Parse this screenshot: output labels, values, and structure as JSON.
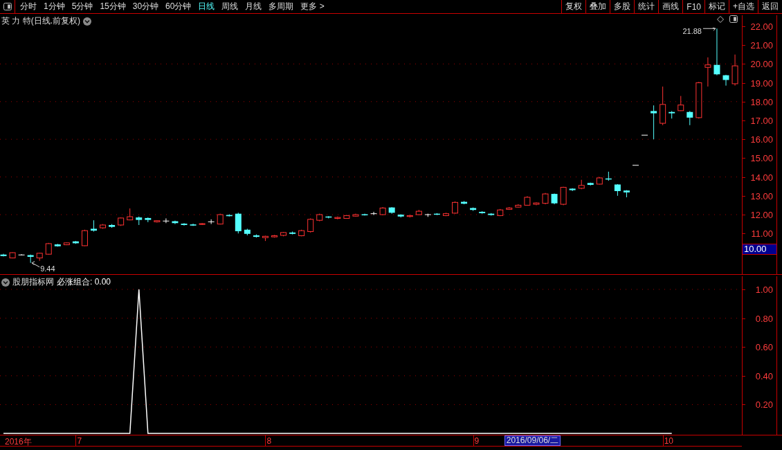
{
  "toolbar": {
    "periods": [
      {
        "label": "分时",
        "selected": false
      },
      {
        "label": "1分钟",
        "selected": false
      },
      {
        "label": "5分钟",
        "selected": false
      },
      {
        "label": "15分钟",
        "selected": false
      },
      {
        "label": "30分钟",
        "selected": false
      },
      {
        "label": "60分钟",
        "selected": false
      },
      {
        "label": "日线",
        "selected": true
      },
      {
        "label": "周线",
        "selected": false
      },
      {
        "label": "月线",
        "selected": false
      },
      {
        "label": "多周期",
        "selected": false
      },
      {
        "label": "更多 >",
        "selected": false
      }
    ],
    "buttons": [
      "复权",
      "叠加",
      "多股",
      "统计",
      "画线",
      "F10",
      "标记",
      "+自选",
      "返回"
    ]
  },
  "main_pane": {
    "title": "英 力 特(日线.前复权)",
    "cursor_price": "10.00",
    "low_label": "9.44",
    "high_label": "21.88",
    "chart_data": {
      "type": "candlestick",
      "ylim": [
        8.84,
        22.66
      ],
      "yticks": [
        {
          "value": 22,
          "label": "22.00"
        },
        {
          "value": 21,
          "label": "21.00"
        },
        {
          "value": 20,
          "label": "20.00"
        },
        {
          "value": 19,
          "label": "19.00"
        },
        {
          "value": 18,
          "label": "18.00"
        },
        {
          "value": 17,
          "label": "17.00"
        },
        {
          "value": 16,
          "label": "16.00"
        },
        {
          "value": 15,
          "label": "15.00"
        },
        {
          "value": 14,
          "label": "14.00"
        },
        {
          "value": 13,
          "label": "13.00"
        },
        {
          "value": 12,
          "label": "12.00"
        },
        {
          "value": 11,
          "label": "11.00"
        }
      ],
      "grid": true,
      "categories": [
        null,
        null,
        null,
        null,
        null,
        null,
        null,
        null,
        null,
        null,
        null,
        null,
        null,
        null,
        null,
        null,
        null,
        null,
        null,
        null,
        null,
        null,
        null,
        null,
        null,
        null,
        null,
        null,
        null,
        null,
        null,
        null,
        null,
        null,
        null,
        null,
        null,
        null,
        null,
        null,
        null,
        null,
        null,
        null,
        null,
        null,
        null,
        null,
        null,
        null,
        null,
        null,
        null,
        null,
        null,
        null,
        null,
        null,
        null,
        null,
        null,
        null,
        null,
        null,
        null,
        null,
        null,
        null,
        null,
        null,
        null,
        null,
        null,
        null,
        null,
        null,
        null,
        null,
        null,
        null,
        null,
        null
      ],
      "ohlc": [
        [
          9.88,
          9.92,
          9.78,
          9.8
        ],
        [
          9.7,
          10.0,
          9.68,
          9.98
        ],
        [
          9.86,
          9.9,
          9.84,
          9.86
        ],
        [
          9.85,
          9.88,
          9.44,
          9.76
        ],
        [
          9.7,
          9.98,
          9.55,
          9.95
        ],
        [
          9.9,
          10.5,
          9.88,
          10.46
        ],
        [
          10.42,
          10.45,
          10.3,
          10.32
        ],
        [
          10.4,
          10.52,
          10.38,
          10.5
        ],
        [
          10.58,
          10.6,
          10.45,
          10.48
        ],
        [
          10.35,
          11.2,
          10.33,
          11.15
        ],
        [
          11.25,
          11.7,
          11.1,
          11.15
        ],
        [
          11.3,
          11.5,
          11.25,
          11.45
        ],
        [
          11.45,
          11.5,
          11.3,
          11.35
        ],
        [
          11.45,
          11.85,
          11.4,
          11.82
        ],
        [
          11.72,
          12.33,
          11.7,
          11.89
        ],
        [
          11.85,
          11.9,
          11.45,
          11.72
        ],
        [
          11.82,
          11.85,
          11.6,
          11.72
        ],
        [
          11.62,
          11.7,
          11.58,
          11.68
        ],
        [
          11.66,
          11.8,
          11.55,
          11.66
        ],
        [
          11.65,
          11.68,
          11.5,
          11.55
        ],
        [
          11.52,
          11.55,
          11.42,
          11.45
        ],
        [
          11.48,
          11.52,
          11.4,
          11.42
        ],
        [
          11.48,
          11.55,
          11.45,
          11.52
        ],
        [
          11.62,
          11.75,
          11.5,
          11.62
        ],
        [
          11.5,
          12.05,
          11.48,
          12.0
        ],
        [
          11.98,
          12.02,
          11.9,
          11.92
        ],
        [
          12.05,
          12.1,
          11.0,
          11.12
        ],
        [
          11.2,
          11.25,
          10.9,
          10.98
        ],
        [
          10.9,
          10.95,
          10.78,
          10.82
        ],
        [
          10.78,
          10.88,
          10.6,
          10.85
        ],
        [
          10.82,
          10.92,
          10.78,
          10.88
        ],
        [
          10.9,
          11.08,
          10.85,
          11.05
        ],
        [
          11.05,
          11.1,
          10.95,
          10.98
        ],
        [
          10.88,
          11.2,
          10.85,
          11.15
        ],
        [
          11.1,
          11.8,
          11.05,
          11.75
        ],
        [
          11.7,
          12.05,
          11.65,
          12.0
        ],
        [
          11.9,
          11.92,
          11.8,
          11.85
        ],
        [
          11.8,
          11.9,
          11.75,
          11.85
        ],
        [
          11.8,
          11.98,
          11.78,
          11.95
        ],
        [
          11.92,
          12.05,
          11.9,
          12.0
        ],
        [
          12.02,
          12.05,
          11.95,
          11.98
        ],
        [
          12.05,
          12.15,
          11.98,
          12.05
        ],
        [
          12.0,
          12.4,
          11.98,
          12.35
        ],
        [
          12.38,
          12.4,
          12.05,
          12.1
        ],
        [
          12.0,
          12.02,
          11.85,
          11.9
        ],
        [
          11.9,
          11.98,
          11.85,
          11.95
        ],
        [
          12.0,
          12.25,
          11.98,
          12.18
        ],
        [
          12.0,
          12.05,
          11.88,
          12.0
        ],
        [
          12.05,
          12.08,
          11.98,
          12.0
        ],
        [
          11.95,
          12.1,
          11.92,
          12.05
        ],
        [
          12.08,
          12.7,
          12.05,
          12.65
        ],
        [
          12.68,
          12.72,
          12.55,
          12.58
        ],
        [
          12.35,
          12.38,
          12.2,
          12.25
        ],
        [
          12.15,
          12.18,
          12.05,
          12.08
        ],
        [
          12.05,
          12.08,
          11.95,
          11.98
        ],
        [
          11.95,
          12.3,
          11.92,
          12.25
        ],
        [
          12.28,
          12.4,
          12.25,
          12.35
        ],
        [
          12.4,
          12.55,
          12.38,
          12.5
        ],
        [
          12.5,
          12.98,
          12.48,
          12.92
        ],
        [
          12.55,
          12.65,
          12.5,
          12.62
        ],
        [
          12.6,
          13.15,
          12.55,
          13.1
        ],
        [
          13.1,
          13.12,
          12.55,
          12.6
        ],
        [
          12.55,
          13.48,
          12.5,
          13.45
        ],
        [
          13.38,
          13.4,
          13.25,
          13.3
        ],
        [
          13.4,
          13.85,
          13.35,
          13.55
        ],
        [
          13.68,
          13.7,
          13.55,
          13.58
        ],
        [
          13.62,
          14.0,
          13.6,
          13.95
        ],
        [
          13.92,
          14.28,
          13.8,
          13.88
        ],
        [
          13.6,
          13.62,
          13.0,
          13.25
        ],
        [
          13.28,
          13.3,
          12.92,
          13.18
        ],
        [
          14.62,
          14.62,
          14.62,
          14.62
        ],
        [
          16.22,
          16.22,
          16.22,
          16.22
        ],
        [
          17.5,
          17.8,
          16.0,
          17.38
        ],
        [
          16.85,
          18.8,
          16.75,
          17.85
        ],
        [
          17.45,
          17.5,
          17.1,
          17.38
        ],
        [
          17.52,
          18.3,
          17.5,
          17.82
        ],
        [
          17.45,
          17.5,
          16.75,
          17.15
        ],
        [
          17.15,
          19.05,
          17.1,
          19.0
        ],
        [
          19.82,
          20.35,
          18.8,
          19.95
        ],
        [
          19.95,
          21.88,
          19.4,
          19.45
        ],
        [
          19.4,
          19.42,
          18.85,
          19.15
        ],
        [
          18.95,
          20.5,
          18.85,
          19.9
        ]
      ]
    }
  },
  "indicator_pane": {
    "source": "股朋指标网",
    "reading": "必涨组合: 0.00",
    "chart_data": {
      "type": "line",
      "ylim": [
        0,
        1
      ],
      "grid": true,
      "yticks": [
        {
          "value": 1,
          "label": "1.00"
        },
        {
          "value": 0.8,
          "label": "0.80"
        },
        {
          "value": 0.6,
          "label": "0.60"
        },
        {
          "value": 0.4,
          "label": "0.40"
        },
        {
          "value": 0.2,
          "label": "0.20"
        }
      ],
      "series": [
        {
          "color": "#ffffff",
          "values": [
            0,
            0,
            0,
            0,
            0,
            0,
            0,
            0,
            0,
            0,
            0,
            0,
            0,
            0,
            0,
            1,
            0,
            0,
            0,
            0,
            0,
            0,
            0,
            0,
            0,
            0,
            0,
            0,
            0,
            0,
            0,
            0,
            0,
            0,
            0,
            0,
            0,
            0,
            0,
            0,
            0,
            0,
            0,
            0,
            0,
            0,
            0,
            0,
            0,
            0,
            0,
            0,
            0,
            0,
            0,
            0,
            0,
            0,
            0,
            0,
            0,
            0,
            0,
            0,
            0,
            0,
            0,
            0,
            0,
            0,
            0,
            0,
            0,
            0,
            0
          ]
        }
      ]
    }
  },
  "date_bar": {
    "labels": [
      "2016年",
      "7",
      "8",
      "9",
      "10"
    ],
    "cursor_date": "2016/09/06/二"
  }
}
